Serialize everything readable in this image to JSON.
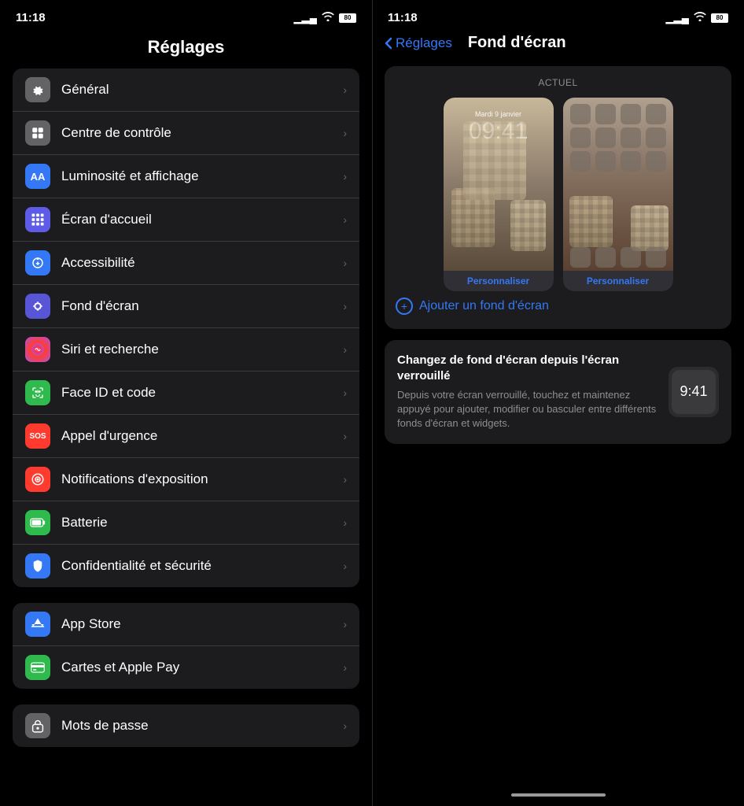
{
  "left": {
    "status": {
      "time": "11:18",
      "battery": "80"
    },
    "title": "Réglages",
    "groups": [
      {
        "id": "main",
        "items": [
          {
            "id": "general",
            "label": "Général",
            "icon": "⚙️",
            "iconClass": "icon-general"
          },
          {
            "id": "controle",
            "label": "Centre de contrôle",
            "icon": "⊞",
            "iconClass": "icon-control"
          },
          {
            "id": "luminosite",
            "label": "Luminosité et affichage",
            "icon": "AA",
            "iconClass": "icon-display"
          },
          {
            "id": "ecran",
            "label": "Écran d'accueil",
            "icon": "⠿",
            "iconClass": "icon-home"
          },
          {
            "id": "access",
            "label": "Accessibilité",
            "icon": "♿",
            "iconClass": "icon-access"
          },
          {
            "id": "wallpaper",
            "label": "Fond d'écran",
            "icon": "✿",
            "iconClass": "icon-wallpaper"
          },
          {
            "id": "siri",
            "label": "Siri et recherche",
            "icon": "◉",
            "iconClass": "icon-siri"
          },
          {
            "id": "faceid",
            "label": "Face ID et code",
            "icon": "👤",
            "iconClass": "icon-faceid"
          },
          {
            "id": "sos",
            "label": "Appel d'urgence",
            "icon": "SOS",
            "iconClass": "icon-sos",
            "sosBg": true
          },
          {
            "id": "notifexp",
            "label": "Notifications d'exposition",
            "icon": "◎",
            "iconClass": "icon-notif"
          },
          {
            "id": "batterie",
            "label": "Batterie",
            "icon": "▬",
            "iconClass": "icon-battery"
          },
          {
            "id": "privacy",
            "label": "Confidentialité et sécurité",
            "icon": "✋",
            "iconClass": "icon-privacy"
          }
        ]
      },
      {
        "id": "apps",
        "items": [
          {
            "id": "appstore",
            "label": "App Store",
            "icon": "A",
            "iconClass": "icon-appstore"
          },
          {
            "id": "cartes",
            "label": "Cartes et Apple Pay",
            "icon": "💳",
            "iconClass": "icon-cartes"
          }
        ]
      },
      {
        "id": "security",
        "items": [
          {
            "id": "password",
            "label": "Mots de passe",
            "icon": "🔑",
            "iconClass": "icon-password"
          }
        ]
      }
    ]
  },
  "right": {
    "status": {
      "time": "11:18",
      "battery": "80"
    },
    "back_label": "Réglages",
    "title": "Fond d'écran",
    "actuel_label": "ACTUEL",
    "lock_date": "Mardi 9 janvier",
    "lock_time": "09:41",
    "personaliser_label": "Personnaliser",
    "add_label": "Ajouter un fond d'écran",
    "tip_title": "Changez de fond d'écran depuis l'écran verrouillé",
    "tip_desc": "Depuis votre écran verrouillé, touchez et maintenez appuyé pour ajouter, modifier ou basculer entre différents fonds d'écran et widgets.",
    "tip_time": "9:41"
  }
}
